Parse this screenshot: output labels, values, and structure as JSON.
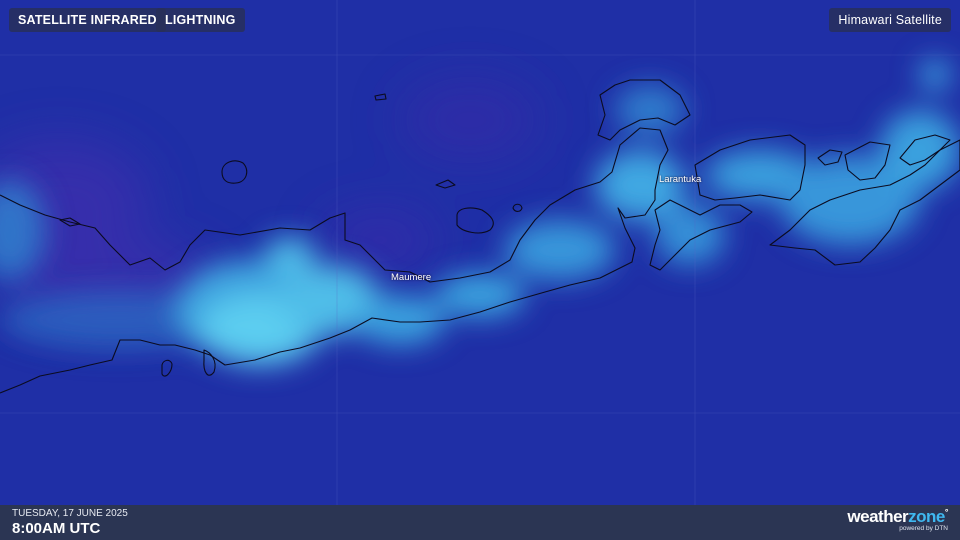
{
  "toolbar": {
    "infrared_label": "SATELLITE INFRARED",
    "lightning_label": "LIGHTNING",
    "source_label": "Himawari Satellite"
  },
  "map": {
    "places": [
      {
        "name": "Larantuka"
      },
      {
        "name": "Maumere"
      }
    ],
    "colors": {
      "background": "#1f2fa6",
      "cloud_light": "#55c8ee",
      "cloud_mid": "#2f86cf",
      "purple_haze": "#4a2fb0",
      "coastline": "#0b0b20"
    }
  },
  "footer": {
    "date": "TUESDAY, 17 JUNE 2025",
    "time": "8:00AM UTC",
    "brand_main": "weather",
    "brand_accent": "zone",
    "brand_sub": "powered by DTN"
  }
}
